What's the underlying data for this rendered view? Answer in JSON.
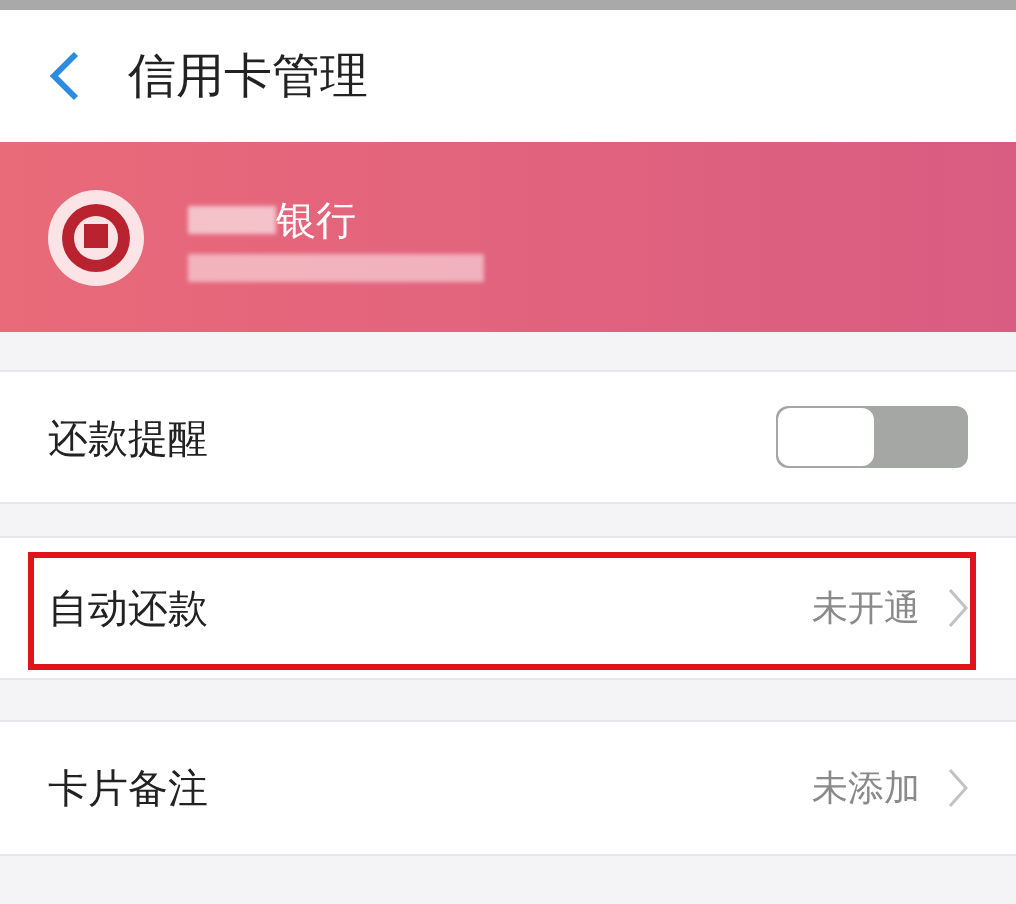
{
  "header": {
    "title": "信用卡管理"
  },
  "card": {
    "bank_name_visible": "银行"
  },
  "rows": [
    {
      "kind": "toggle",
      "label": "还款提醒",
      "on": false,
      "highlighted": false
    },
    {
      "kind": "link",
      "label": "自动还款",
      "value": "未开通",
      "highlighted": true
    },
    {
      "kind": "link",
      "label": "卡片备注",
      "value": "未添加",
      "highlighted": false
    }
  ]
}
